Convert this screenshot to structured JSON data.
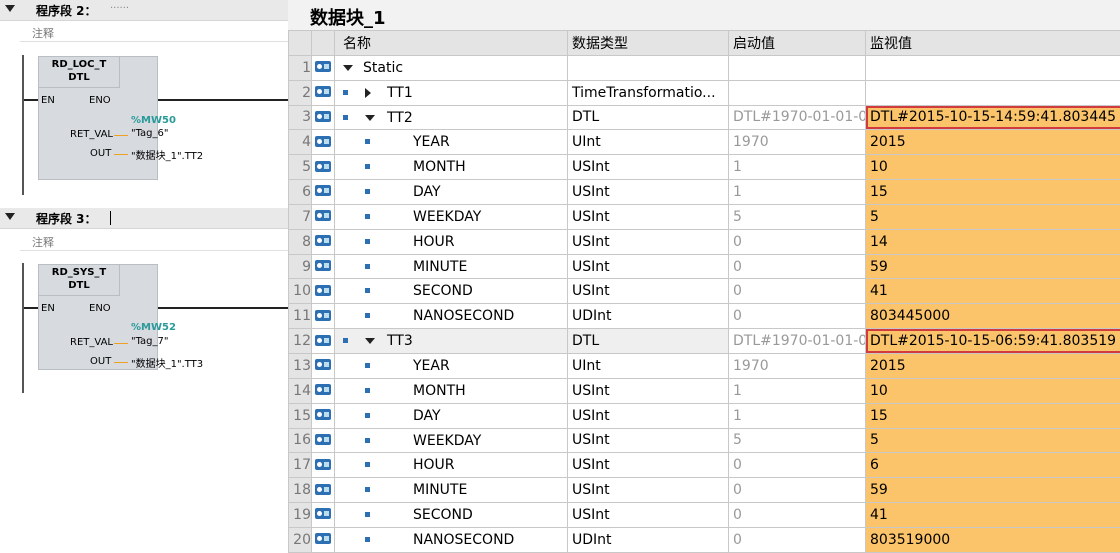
{
  "network2": {
    "title": "程序段 2：",
    "dots": "......",
    "comment": "注释",
    "block_name": "RD_LOC_T",
    "block_type": "DTL",
    "en": "EN",
    "eno": "ENO",
    "ret_label": "RET_VAL",
    "out_label": "OUT",
    "ret_address": "%MW50",
    "ret_tag": "\"Tag_6\"",
    "out_tag": "\"数据块_1\".TT2"
  },
  "network3": {
    "title": "程序段 3：",
    "comment": "注释",
    "block_name": "RD_SYS_T",
    "block_type": "DTL",
    "en": "EN",
    "eno": "ENO",
    "ret_label": "RET_VAL",
    "out_label": "OUT",
    "ret_address": "%MW52",
    "ret_tag": "\"Tag_7\"",
    "out_tag": "\"数据块_1\".TT3"
  },
  "db": {
    "title": "数据块_1",
    "headers": {
      "name": "名称",
      "type": "数据类型",
      "start": "启动值",
      "monitor": "监视值"
    },
    "rows": [
      {
        "num": "1",
        "name": "Static",
        "type": "",
        "start": "",
        "monitor": ""
      },
      {
        "num": "2",
        "name": "TT1",
        "type": "TimeTransformatio...",
        "start": "",
        "monitor": ""
      },
      {
        "num": "3",
        "name": "TT2",
        "type": "DTL",
        "start": "DTL#1970-01-01-0",
        "monitor": "DTL#2015-10-15-14:59:41.803445"
      },
      {
        "num": "4",
        "name": "YEAR",
        "type": "UInt",
        "start": "1970",
        "monitor": "2015"
      },
      {
        "num": "5",
        "name": "MONTH",
        "type": "USInt",
        "start": "1",
        "monitor": "10"
      },
      {
        "num": "6",
        "name": "DAY",
        "type": "USInt",
        "start": "1",
        "monitor": "15"
      },
      {
        "num": "7",
        "name": "WEEKDAY",
        "type": "USInt",
        "start": "5",
        "monitor": "5"
      },
      {
        "num": "8",
        "name": "HOUR",
        "type": "USInt",
        "start": "0",
        "monitor": "14"
      },
      {
        "num": "9",
        "name": "MINUTE",
        "type": "USInt",
        "start": "0",
        "monitor": "59"
      },
      {
        "num": "10",
        "name": "SECOND",
        "type": "USInt",
        "start": "0",
        "monitor": "41"
      },
      {
        "num": "11",
        "name": "NANOSECOND",
        "type": "UDInt",
        "start": "0",
        "monitor": "803445000"
      },
      {
        "num": "12",
        "name": "TT3",
        "type": "DTL",
        "start": "DTL#1970-01-01-0",
        "monitor": "DTL#2015-10-15-06:59:41.803519"
      },
      {
        "num": "13",
        "name": "YEAR",
        "type": "UInt",
        "start": "1970",
        "monitor": "2015"
      },
      {
        "num": "14",
        "name": "MONTH",
        "type": "USInt",
        "start": "1",
        "monitor": "10"
      },
      {
        "num": "15",
        "name": "DAY",
        "type": "USInt",
        "start": "1",
        "monitor": "15"
      },
      {
        "num": "16",
        "name": "WEEKDAY",
        "type": "USInt",
        "start": "5",
        "monitor": "5"
      },
      {
        "num": "17",
        "name": "HOUR",
        "type": "USInt",
        "start": "0",
        "monitor": "6"
      },
      {
        "num": "18",
        "name": "MINUTE",
        "type": "USInt",
        "start": "0",
        "monitor": "59"
      },
      {
        "num": "19",
        "name": "SECOND",
        "type": "USInt",
        "start": "0",
        "monitor": "41"
      },
      {
        "num": "20",
        "name": "NANOSECOND",
        "type": "UDInt",
        "start": "0",
        "monitor": "803519000"
      }
    ]
  },
  "colors": {
    "monitor_fill": "#fcc46a",
    "highlight_border": "#d23b3b",
    "db_icon": "#2c6fb2",
    "address": "#2a9a9a"
  }
}
